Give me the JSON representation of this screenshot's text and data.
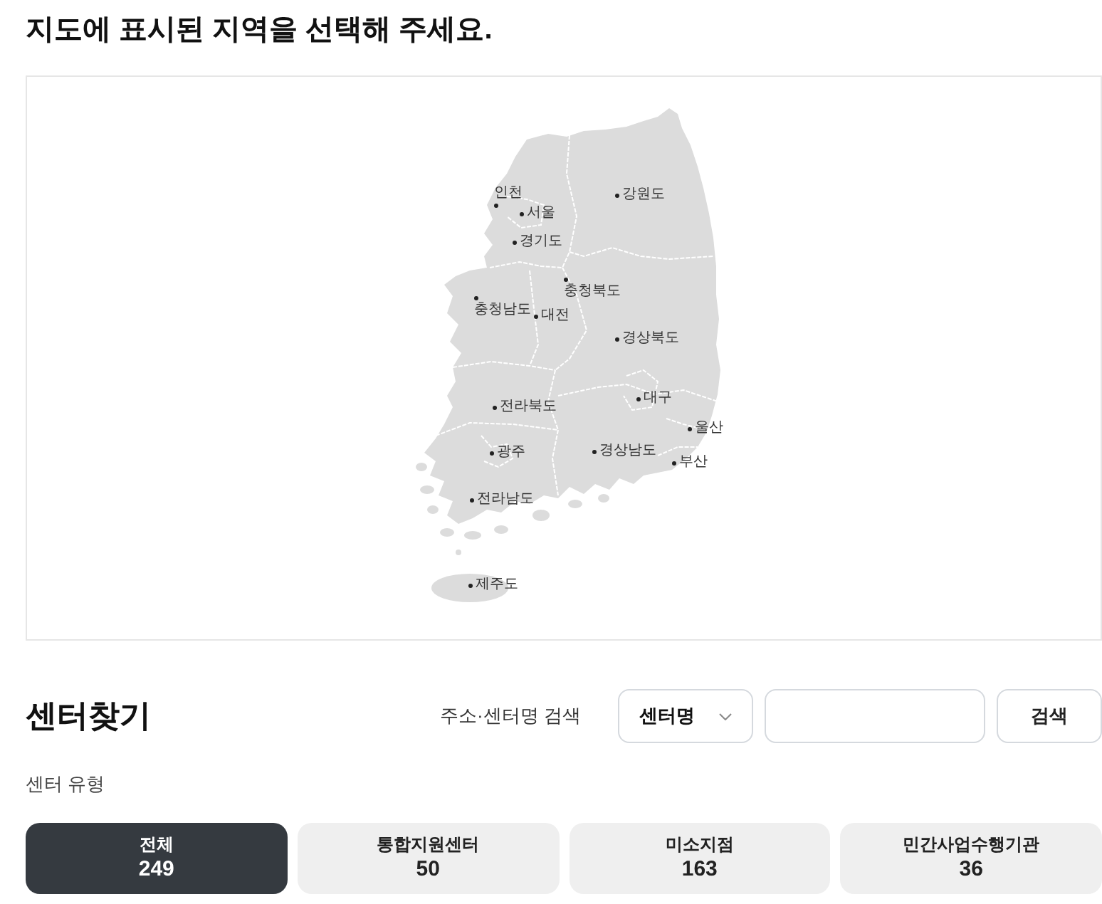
{
  "page": {
    "title": "지도에 표시된 지역을 선택해 주세요."
  },
  "map": {
    "regions": [
      "인천",
      "강원도",
      "서울",
      "경기도",
      "충청북도",
      "충청남도",
      "대전",
      "경상북도",
      "대구",
      "전라북도",
      "울산",
      "경상남도",
      "광주",
      "부산",
      "전라남도",
      "제주도"
    ]
  },
  "center_search": {
    "heading": "센터찾기",
    "search_label": "주소·센터명 검색",
    "search_type": "센터명",
    "search_button": "검색"
  },
  "center_types": {
    "label": "센터 유형",
    "tabs": [
      {
        "label": "전체",
        "count": "249",
        "selected": true
      },
      {
        "label": "통합지원센터",
        "count": "50",
        "selected": false
      },
      {
        "label": "미소지점",
        "count": "163",
        "selected": false
      },
      {
        "label": "민간사업수행기관",
        "count": "36",
        "selected": false
      }
    ]
  }
}
